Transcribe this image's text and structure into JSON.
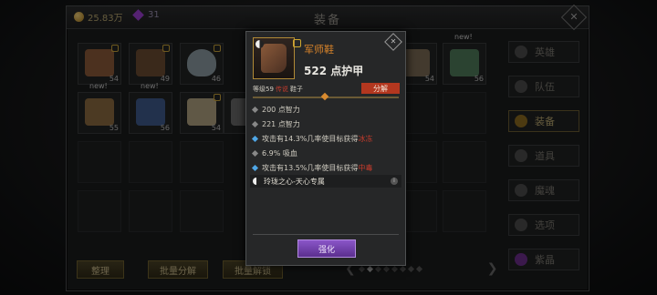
{
  "currency": {
    "gold": "25.83万",
    "gems": "31"
  },
  "window": {
    "title": "装备",
    "close_icon": "close-icon"
  },
  "bag_items": [
    {
      "icon": "boots-icon",
      "count": "54",
      "color": "#8a5a3a"
    },
    {
      "icon": "belt-icon",
      "count": "49",
      "color": "#6b4c32"
    },
    {
      "icon": "helm-icon",
      "count": "46",
      "color": "#8a9aa0"
    },
    {
      "icon": "gloves-icon",
      "count": "54",
      "color": "#7a6a55"
    },
    {
      "icon": "armor-icon",
      "count": "56",
      "color": "#4f7a5a"
    },
    {
      "icon": "bracer-icon",
      "count": "55",
      "color": "#8a6a40",
      "tag": "new!"
    },
    {
      "icon": "cape-icon",
      "count": "56",
      "color": "#3f5a8a",
      "tag": "new!"
    },
    {
      "icon": "gauntlet-icon",
      "count": "54",
      "color": "#b0a080"
    },
    {
      "icon": "leg-icon",
      "count": "54",
      "color": "#6a6a6a"
    }
  ],
  "sidebar": {
    "items": [
      {
        "label": "英雄",
        "icon": "heroes-icon"
      },
      {
        "label": "队伍",
        "icon": "flag-icon"
      },
      {
        "label": "装备",
        "icon": "helmet-icon"
      },
      {
        "label": "道具",
        "icon": "potion-icon"
      },
      {
        "label": "魔魂",
        "icon": "soul-icon"
      },
      {
        "label": "选项",
        "icon": "gear-icon"
      },
      {
        "label": "紫晶",
        "icon": "crystal-icon"
      }
    ]
  },
  "bottom": {
    "sort": "整理",
    "batch_decompose": "批量分解",
    "batch_unlock": "批量解锁"
  },
  "popup": {
    "name": "军师鞋",
    "armor": "522 点护甲",
    "level": "等级59",
    "quality": "传说",
    "slot": "鞋子",
    "decompose": "分解",
    "stats": [
      {
        "text": "200 点智力",
        "kind": "base"
      },
      {
        "text": "221 点智力",
        "kind": "base"
      },
      {
        "text": "攻击有14.3%几率使目标获得",
        "highlight": "冰冻",
        "kind": "special"
      },
      {
        "text": "6.9% 吸血",
        "kind": "base"
      },
      {
        "text": "攻击有13.5%几率使目标获得",
        "highlight": "中毒",
        "kind": "special"
      }
    ],
    "set": "玲珑之心-天心专属",
    "enhance": "强化"
  }
}
